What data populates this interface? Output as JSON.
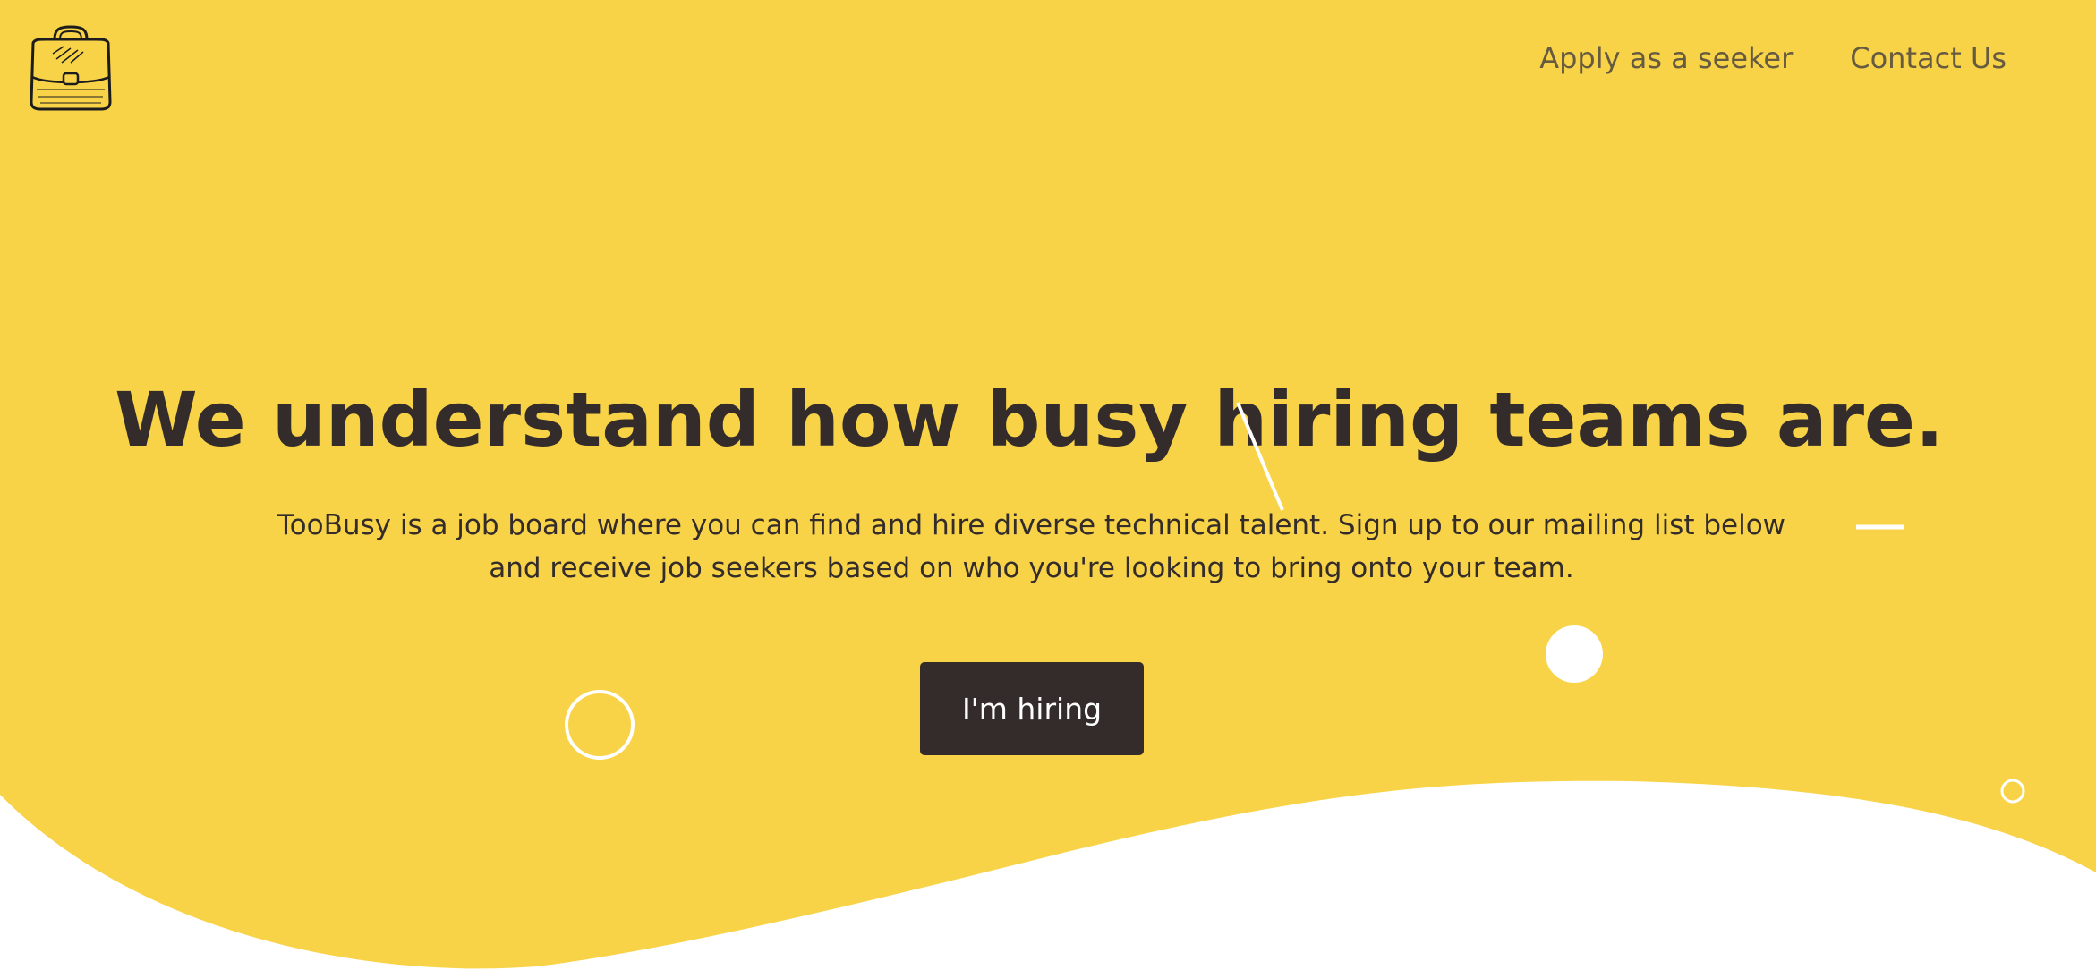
{
  "nav": {
    "apply_label": "Apply as a seeker",
    "contact_label": "Contact Us"
  },
  "hero": {
    "headline": "We understand how busy hiring teams are.",
    "subtext": "TooBusy is a job board where you can find and hire diverse technical talent. Sign up to our mailing list below and receive job seekers based on who you're looking to bring onto your team.",
    "cta_label": "I'm hiring"
  },
  "colors": {
    "brand_yellow": "#f8d347",
    "text_dark": "#332c2b",
    "nav_text": "#665a41",
    "button_bg": "#332c2b",
    "button_text": "#ffffff"
  },
  "icons": {
    "logo": "briefcase-icon"
  }
}
